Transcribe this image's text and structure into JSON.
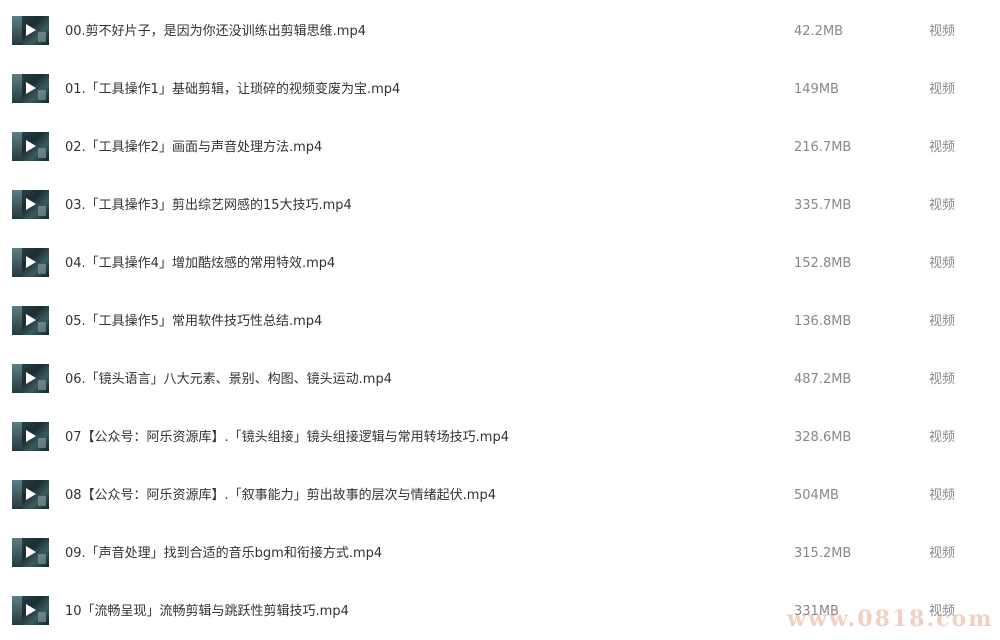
{
  "files": [
    {
      "name": "00.剪不好片子，是因为你还没训练出剪辑思维.mp4",
      "size": "42.2MB",
      "type": "视频",
      "icon": "video-thumbnail-icon"
    },
    {
      "name": "01.「工具操作1」基础剪辑，让琐碎的视频变废为宝.mp4",
      "size": "149MB",
      "type": "视频",
      "icon": "video-thumbnail-icon"
    },
    {
      "name": "02.「工具操作2」画面与声音处理方法.mp4",
      "size": "216.7MB",
      "type": "视频",
      "icon": "video-thumbnail-icon"
    },
    {
      "name": "03.「工具操作3」剪出综艺网感的15大技巧.mp4",
      "size": "335.7MB",
      "type": "视频",
      "icon": "video-thumbnail-icon"
    },
    {
      "name": "04.「工具操作4」增加酷炫感的常用特效.mp4",
      "size": "152.8MB",
      "type": "视频",
      "icon": "video-thumbnail-icon"
    },
    {
      "name": "05.「工具操作5」常用软件技巧性总结.mp4",
      "size": "136.8MB",
      "type": "视频",
      "icon": "video-thumbnail-icon"
    },
    {
      "name": "06.「镜头语言」八大元素、景别、构图、镜头运动.mp4",
      "size": "487.2MB",
      "type": "视频",
      "icon": "video-thumbnail-icon"
    },
    {
      "name": "07【公众号：阿乐资源库】.「镜头组接」镜头组接逻辑与常用转场技巧.mp4",
      "size": "328.6MB",
      "type": "视频",
      "icon": "video-thumbnail-icon"
    },
    {
      "name": "08【公众号：阿乐资源库】.「叙事能力」剪出故事的层次与情绪起伏.mp4",
      "size": "504MB",
      "type": "视频",
      "icon": "video-thumbnail-icon"
    },
    {
      "name": "09.「声音处理」找到合适的音乐bgm和衔接方式.mp4",
      "size": "315.2MB",
      "type": "视频",
      "icon": "video-thumbnail-icon"
    },
    {
      "name": "10「流畅呈现」流畅剪辑与跳跃性剪辑技巧.mp4",
      "size": "331MB",
      "type": "视频",
      "icon": "video-thumbnail-icon"
    }
  ],
  "watermark": "www.0818.com"
}
